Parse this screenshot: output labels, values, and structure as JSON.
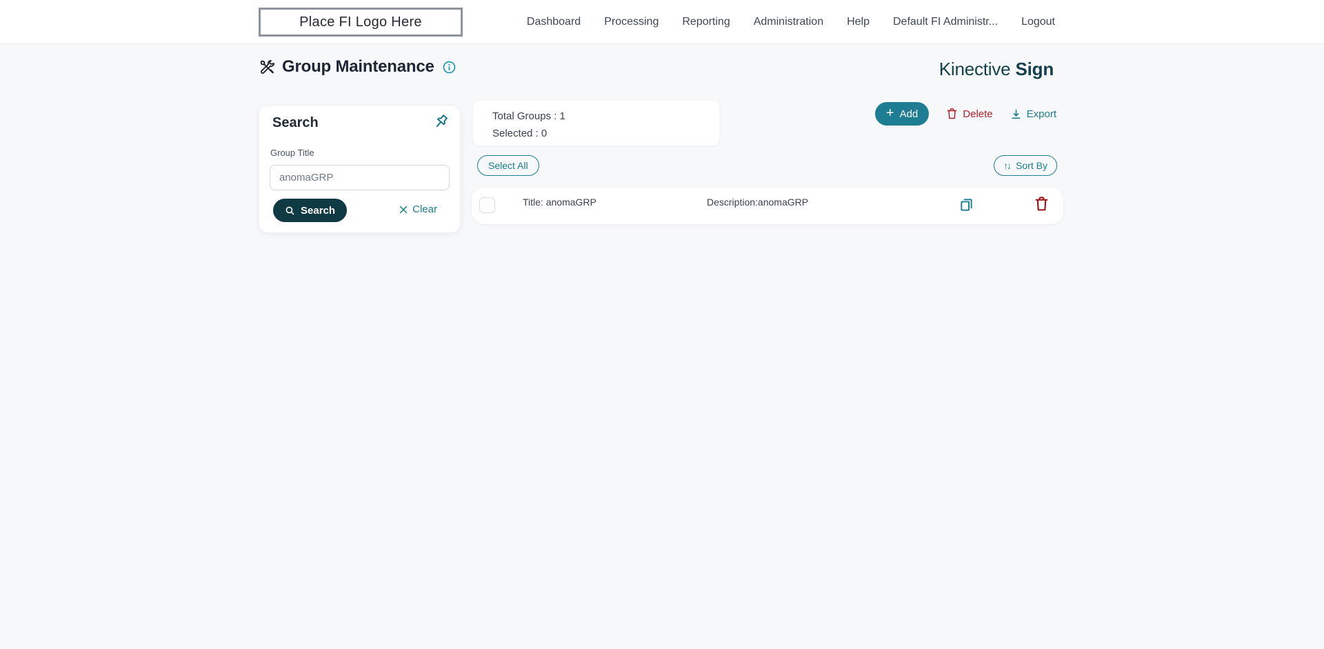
{
  "header": {
    "logo_text": "Place FI Logo Here",
    "nav": [
      "Dashboard",
      "Processing",
      "Reporting",
      "Administration",
      "Help",
      "Default FI Administr...",
      "Logout"
    ]
  },
  "page": {
    "title": "Group Maintenance",
    "brand_name": "Kinective",
    "brand_product": "Sign"
  },
  "search_panel": {
    "title": "Search",
    "group_title_label": "Group Title",
    "group_title_value": "anomaGRP",
    "search_button": "Search",
    "clear_button": "Clear"
  },
  "summary": {
    "total_groups": "Total Groups : 1",
    "selected": "Selected : 0"
  },
  "toolbar": {
    "add": "Add",
    "delete": "Delete",
    "export": "Export",
    "select_all": "Select All",
    "sort_by": "Sort By"
  },
  "groups": [
    {
      "title": "Title: anomaGRP",
      "description": "Description:anomaGRP",
      "selected": false
    }
  ],
  "icons": {
    "add_plus": "+",
    "sort_arrows": "↑↓"
  },
  "colors": {
    "teal_accent": "#1c7c91",
    "add_button_bg": "#1e7d92",
    "search_button_bg": "#103a43",
    "brand_text": "#15404b",
    "delete_red": "#ac1f2b",
    "row_trash_red": "#9c1016",
    "info_teal": "#1b93ad",
    "page_bg": "#f7f8fa",
    "topbar_bg": "#ffffff"
  }
}
